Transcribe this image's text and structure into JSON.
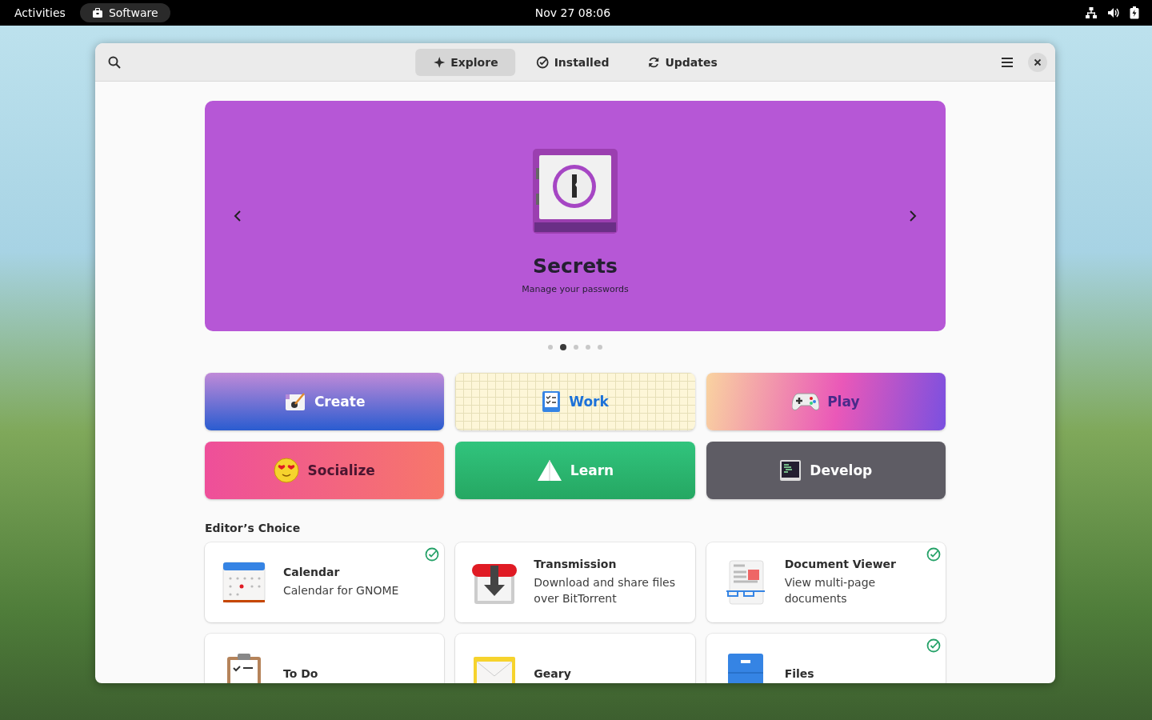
{
  "top_bar": {
    "activities": "Activities",
    "app_name": "Software",
    "clock": "Nov 27  08:06"
  },
  "header": {
    "tabs": [
      {
        "label": "Explore",
        "kind": "explore",
        "selected": true
      },
      {
        "label": "Installed",
        "kind": "installed",
        "selected": false
      },
      {
        "label": "Updates",
        "kind": "updates",
        "selected": false
      }
    ]
  },
  "featured": {
    "title": "Secrets",
    "subtitle": "Manage your passwords",
    "dots": [
      {
        "selected": false
      },
      {
        "selected": true
      },
      {
        "selected": false
      },
      {
        "selected": false
      },
      {
        "selected": false
      }
    ]
  },
  "categories": [
    {
      "label": "Create",
      "kind": "create"
    },
    {
      "label": "Work",
      "kind": "work"
    },
    {
      "label": "Play",
      "kind": "play"
    },
    {
      "label": "Socialize",
      "kind": "socialize"
    },
    {
      "label": "Learn",
      "kind": "learn"
    },
    {
      "label": "Develop",
      "kind": "develop"
    }
  ],
  "editors_choice": {
    "heading": "Editor’s Choice",
    "apps": [
      {
        "name": "Calendar",
        "description": "Calendar for GNOME",
        "installed": true,
        "kind": "calendar"
      },
      {
        "name": "Transmission",
        "description": "Download and share files over BitTorrent",
        "installed": false,
        "kind": "transmission"
      },
      {
        "name": "Document Viewer",
        "description": "View multi-page documents",
        "installed": true,
        "kind": "document"
      },
      {
        "name": "To Do",
        "installed": false,
        "kind": "todo"
      },
      {
        "name": "Geary",
        "installed": false,
        "kind": "mail"
      },
      {
        "name": "Files",
        "installed": true,
        "kind": "files"
      }
    ]
  }
}
